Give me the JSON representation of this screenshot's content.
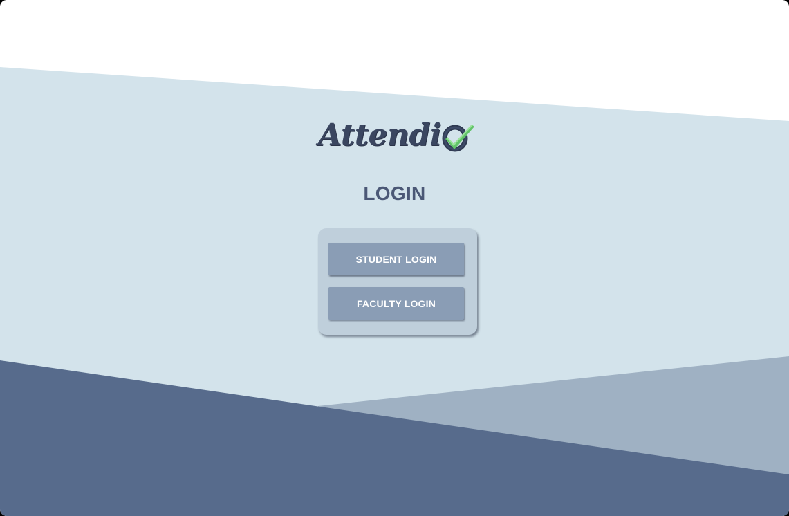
{
  "app": {
    "logo_text": "Attendi",
    "logo_icon": "checkmark-o-icon"
  },
  "login": {
    "title": "LOGIN",
    "student_button_label": "STUDENT LOGIN",
    "faculty_button_label": "FACULTY LOGIN"
  },
  "colors": {
    "background_light": "#d3e3eb",
    "background_top": "#ffffff",
    "wave_dark": "#576b8c",
    "wave_mid": "#9fb1c3",
    "panel": "#bfcfdb",
    "button": "#8a9db5",
    "title_text": "#4b5876",
    "logo_text": "#3a4660",
    "check_green": "#62c46a"
  }
}
